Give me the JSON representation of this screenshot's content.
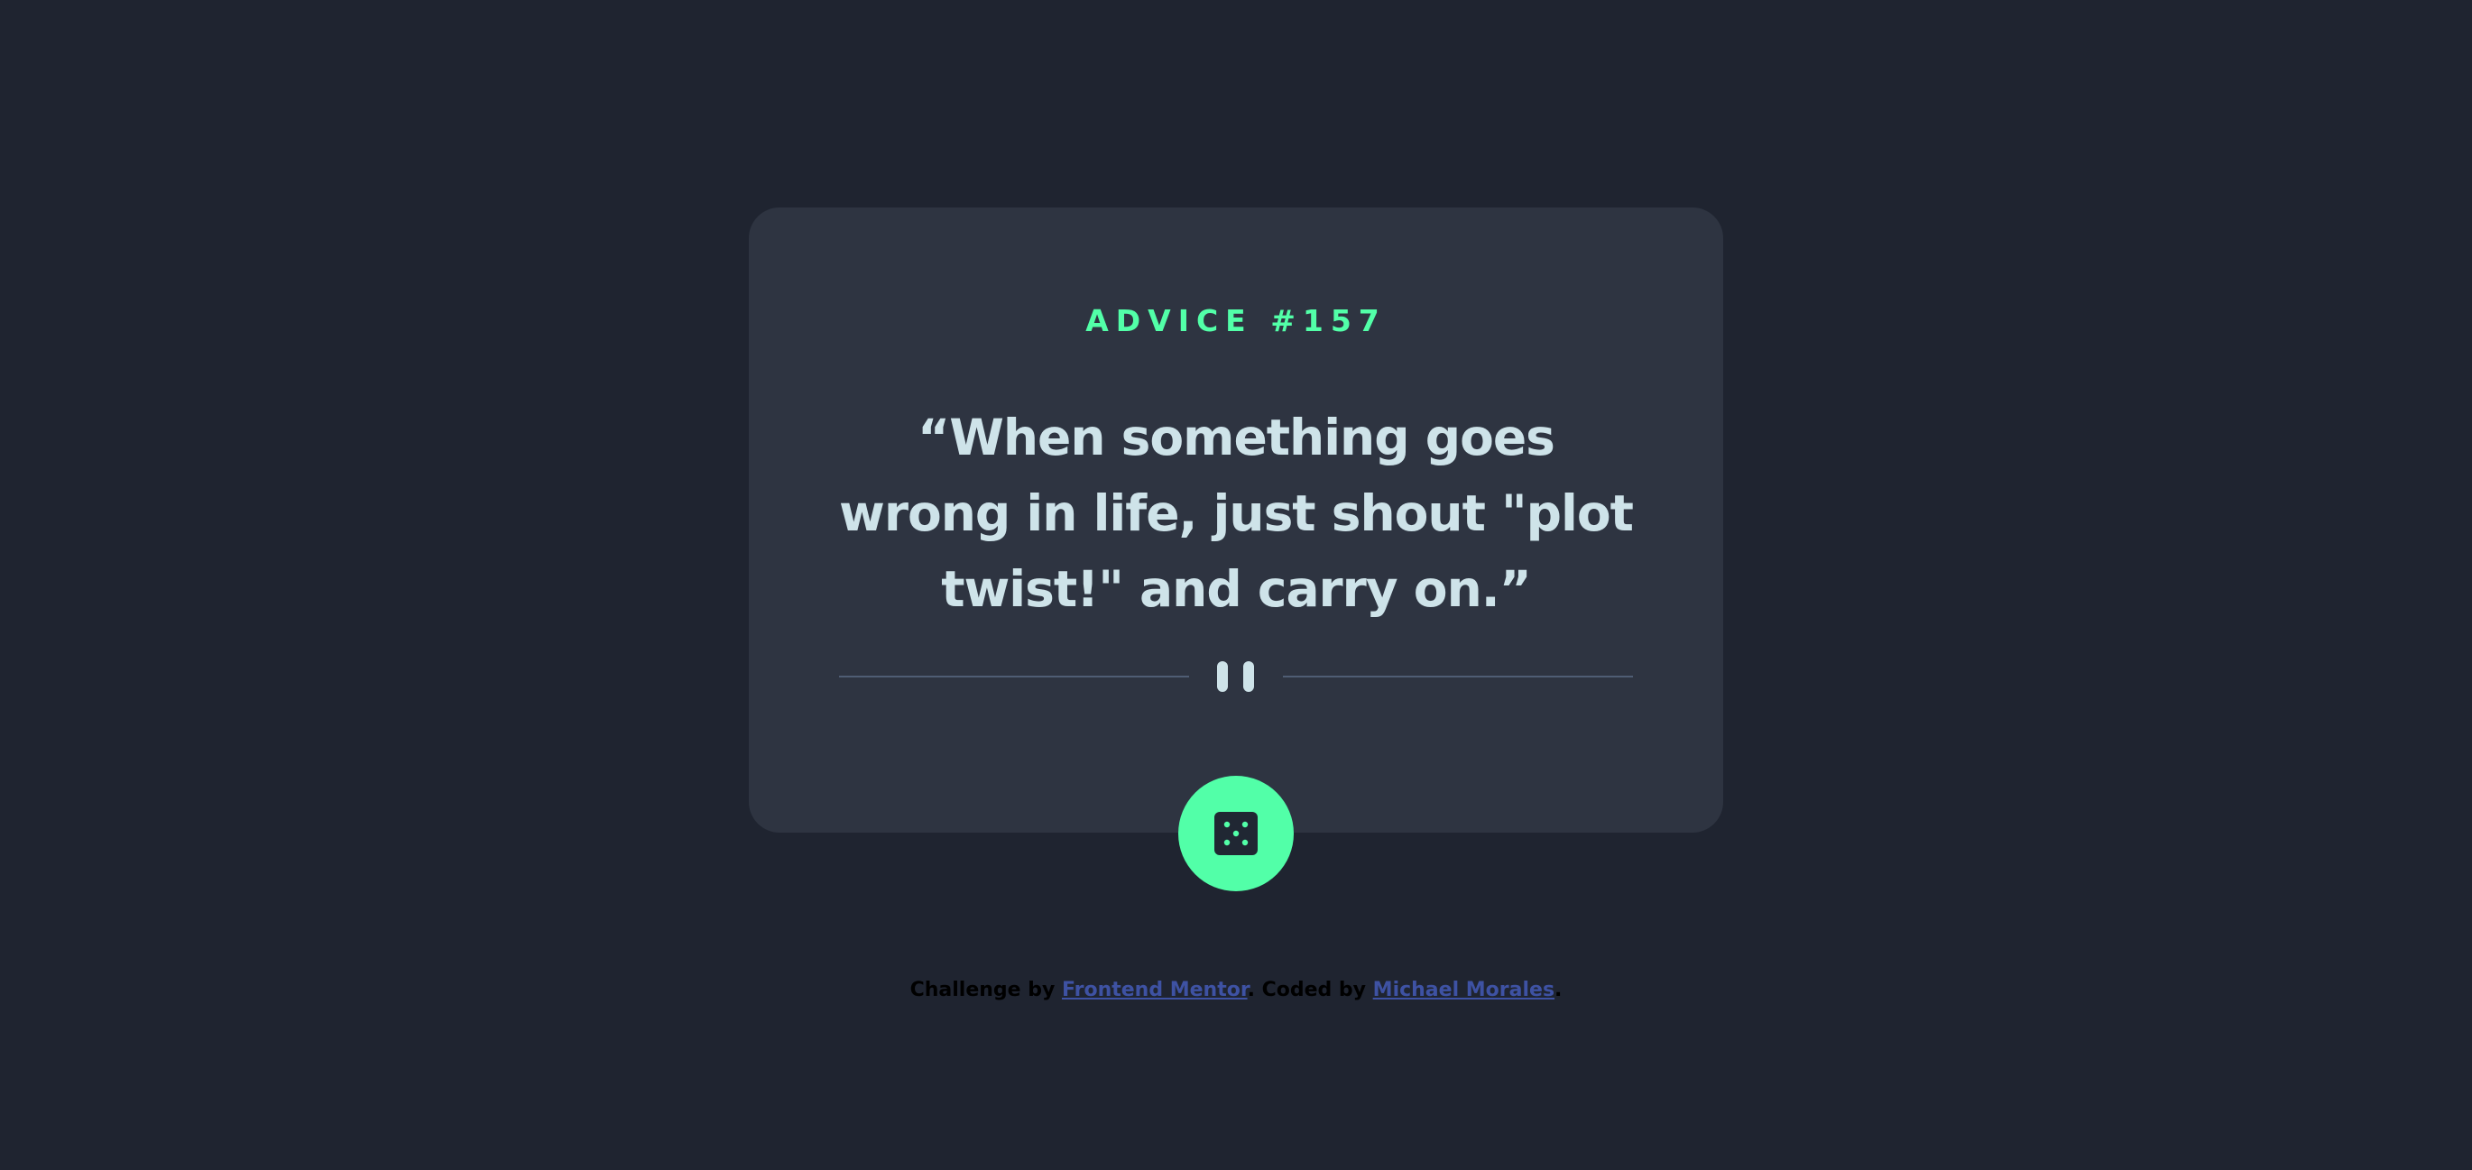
{
  "card": {
    "advice_label": "ADVICE #157",
    "quote": "“When something goes wrong in life, just shout \"plot twist!\" and carry on.”"
  },
  "footer": {
    "challenge_prefix": "Challenge by ",
    "challenge_link": "Frontend Mentor",
    "separator": ". Coded by ",
    "author_link": "Michael Morales",
    "suffix": "."
  },
  "icons": {
    "divider": "pause-icon",
    "button": "dice-icon"
  },
  "colors": {
    "background": "#1f2430",
    "card": "#2e3441",
    "accent": "#52ffa8",
    "quote_text": "#cee3e9",
    "divider_line": "#4f5d74",
    "link": "#3e52a3"
  }
}
